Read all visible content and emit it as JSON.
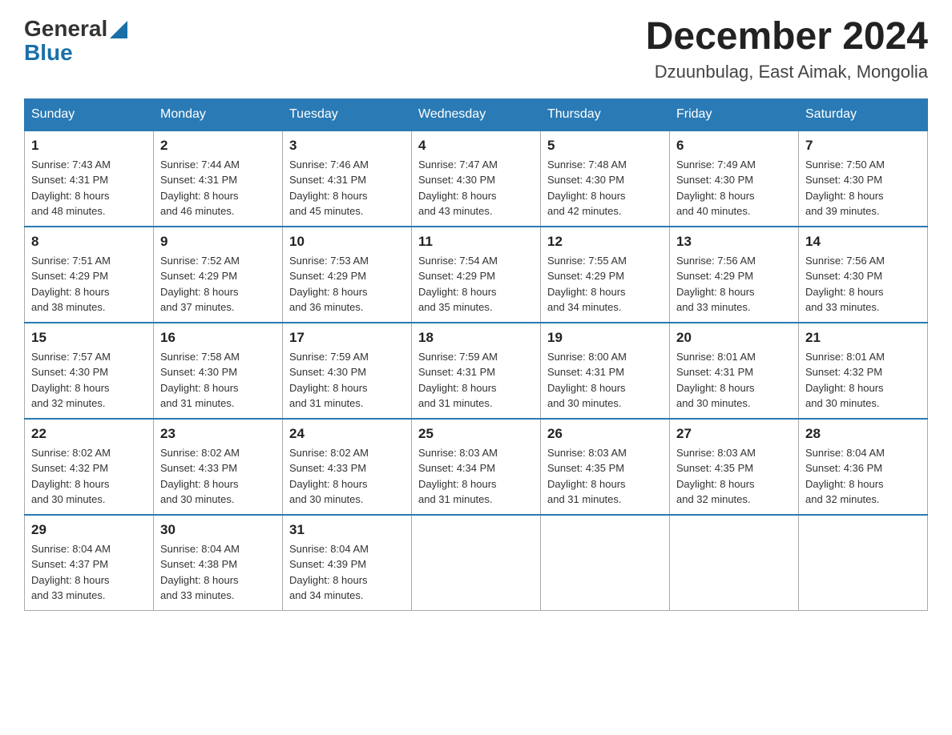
{
  "header": {
    "logo_general": "General",
    "logo_blue": "Blue",
    "month_title": "December 2024",
    "location": "Dzuunbulag, East Aimak, Mongolia"
  },
  "days_of_week": [
    "Sunday",
    "Monday",
    "Tuesday",
    "Wednesday",
    "Thursday",
    "Friday",
    "Saturday"
  ],
  "weeks": [
    [
      {
        "day": "1",
        "sunrise": "7:43 AM",
        "sunset": "4:31 PM",
        "daylight": "8 hours and 48 minutes."
      },
      {
        "day": "2",
        "sunrise": "7:44 AM",
        "sunset": "4:31 PM",
        "daylight": "8 hours and 46 minutes."
      },
      {
        "day": "3",
        "sunrise": "7:46 AM",
        "sunset": "4:31 PM",
        "daylight": "8 hours and 45 minutes."
      },
      {
        "day": "4",
        "sunrise": "7:47 AM",
        "sunset": "4:30 PM",
        "daylight": "8 hours and 43 minutes."
      },
      {
        "day": "5",
        "sunrise": "7:48 AM",
        "sunset": "4:30 PM",
        "daylight": "8 hours and 42 minutes."
      },
      {
        "day": "6",
        "sunrise": "7:49 AM",
        "sunset": "4:30 PM",
        "daylight": "8 hours and 40 minutes."
      },
      {
        "day": "7",
        "sunrise": "7:50 AM",
        "sunset": "4:30 PM",
        "daylight": "8 hours and 39 minutes."
      }
    ],
    [
      {
        "day": "8",
        "sunrise": "7:51 AM",
        "sunset": "4:29 PM",
        "daylight": "8 hours and 38 minutes."
      },
      {
        "day": "9",
        "sunrise": "7:52 AM",
        "sunset": "4:29 PM",
        "daylight": "8 hours and 37 minutes."
      },
      {
        "day": "10",
        "sunrise": "7:53 AM",
        "sunset": "4:29 PM",
        "daylight": "8 hours and 36 minutes."
      },
      {
        "day": "11",
        "sunrise": "7:54 AM",
        "sunset": "4:29 PM",
        "daylight": "8 hours and 35 minutes."
      },
      {
        "day": "12",
        "sunrise": "7:55 AM",
        "sunset": "4:29 PM",
        "daylight": "8 hours and 34 minutes."
      },
      {
        "day": "13",
        "sunrise": "7:56 AM",
        "sunset": "4:29 PM",
        "daylight": "8 hours and 33 minutes."
      },
      {
        "day": "14",
        "sunrise": "7:56 AM",
        "sunset": "4:30 PM",
        "daylight": "8 hours and 33 minutes."
      }
    ],
    [
      {
        "day": "15",
        "sunrise": "7:57 AM",
        "sunset": "4:30 PM",
        "daylight": "8 hours and 32 minutes."
      },
      {
        "day": "16",
        "sunrise": "7:58 AM",
        "sunset": "4:30 PM",
        "daylight": "8 hours and 31 minutes."
      },
      {
        "day": "17",
        "sunrise": "7:59 AM",
        "sunset": "4:30 PM",
        "daylight": "8 hours and 31 minutes."
      },
      {
        "day": "18",
        "sunrise": "7:59 AM",
        "sunset": "4:31 PM",
        "daylight": "8 hours and 31 minutes."
      },
      {
        "day": "19",
        "sunrise": "8:00 AM",
        "sunset": "4:31 PM",
        "daylight": "8 hours and 30 minutes."
      },
      {
        "day": "20",
        "sunrise": "8:01 AM",
        "sunset": "4:31 PM",
        "daylight": "8 hours and 30 minutes."
      },
      {
        "day": "21",
        "sunrise": "8:01 AM",
        "sunset": "4:32 PM",
        "daylight": "8 hours and 30 minutes."
      }
    ],
    [
      {
        "day": "22",
        "sunrise": "8:02 AM",
        "sunset": "4:32 PM",
        "daylight": "8 hours and 30 minutes."
      },
      {
        "day": "23",
        "sunrise": "8:02 AM",
        "sunset": "4:33 PM",
        "daylight": "8 hours and 30 minutes."
      },
      {
        "day": "24",
        "sunrise": "8:02 AM",
        "sunset": "4:33 PM",
        "daylight": "8 hours and 30 minutes."
      },
      {
        "day": "25",
        "sunrise": "8:03 AM",
        "sunset": "4:34 PM",
        "daylight": "8 hours and 31 minutes."
      },
      {
        "day": "26",
        "sunrise": "8:03 AM",
        "sunset": "4:35 PM",
        "daylight": "8 hours and 31 minutes."
      },
      {
        "day": "27",
        "sunrise": "8:03 AM",
        "sunset": "4:35 PM",
        "daylight": "8 hours and 32 minutes."
      },
      {
        "day": "28",
        "sunrise": "8:04 AM",
        "sunset": "4:36 PM",
        "daylight": "8 hours and 32 minutes."
      }
    ],
    [
      {
        "day": "29",
        "sunrise": "8:04 AM",
        "sunset": "4:37 PM",
        "daylight": "8 hours and 33 minutes."
      },
      {
        "day": "30",
        "sunrise": "8:04 AM",
        "sunset": "4:38 PM",
        "daylight": "8 hours and 33 minutes."
      },
      {
        "day": "31",
        "sunrise": "8:04 AM",
        "sunset": "4:39 PM",
        "daylight": "8 hours and 34 minutes."
      },
      null,
      null,
      null,
      null
    ]
  ],
  "labels": {
    "sunrise": "Sunrise:",
    "sunset": "Sunset:",
    "daylight": "Daylight:"
  }
}
